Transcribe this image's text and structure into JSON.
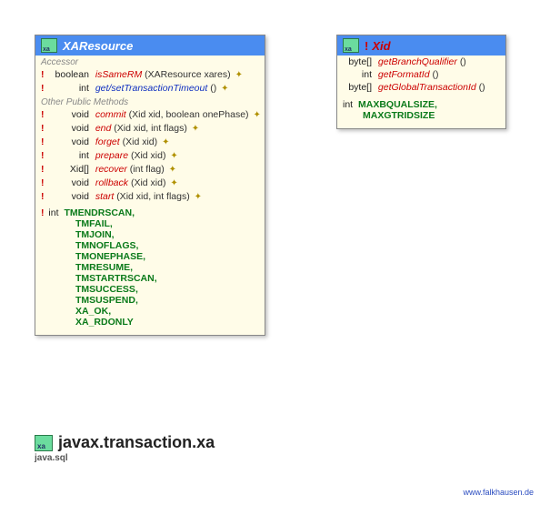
{
  "xaresource": {
    "title": "XAResource",
    "sections": {
      "accessor_label": "Accessor",
      "other_label": "Other Public Methods"
    },
    "accessors": [
      {
        "bang": "!",
        "ret": "boolean",
        "name": "isSameRM",
        "params": "(XAResource xares)",
        "throws": "✦",
        "color": "red"
      },
      {
        "bang": "!",
        "ret": "int",
        "name": "get/setTransactionTimeout",
        "params": "()",
        "throws": "✦",
        "color": "blue"
      }
    ],
    "methods": [
      {
        "bang": "!",
        "ret": "void",
        "name": "commit",
        "params": "(Xid xid, boolean onePhase)",
        "throws": "✦"
      },
      {
        "bang": "!",
        "ret": "void",
        "name": "end",
        "params": "(Xid xid, int flags)",
        "throws": "✦"
      },
      {
        "bang": "!",
        "ret": "void",
        "name": "forget",
        "params": "(Xid xid)",
        "throws": "✦"
      },
      {
        "bang": "!",
        "ret": "int",
        "name": "prepare",
        "params": "(Xid xid)",
        "throws": "✦"
      },
      {
        "bang": "!",
        "ret": "Xid[]",
        "name": "recover",
        "params": "(int flag)",
        "throws": "✦"
      },
      {
        "bang": "!",
        "ret": "void",
        "name": "rollback",
        "params": "(Xid xid)",
        "throws": "✦"
      },
      {
        "bang": "!",
        "ret": "void",
        "name": "start",
        "params": "(Xid xid, int flags)",
        "throws": "✦"
      }
    ],
    "constants": {
      "lead": "!",
      "type": "int",
      "names": [
        "TMENDRSCAN",
        "TMFAIL",
        "TMJOIN",
        "TMNOFLAGS",
        "TMONEPHASE",
        "TMRESUME",
        "TMSTARTRSCAN",
        "TMSUCCESS",
        "TMSUSPEND",
        "XA_OK",
        "XA_RDONLY"
      ]
    }
  },
  "xid": {
    "bang": "!",
    "title": "Xid",
    "methods": [
      {
        "ret": "byte[]",
        "name": "getBranchQualifier",
        "params": "()"
      },
      {
        "ret": "int",
        "name": "getFormatId",
        "params": "()"
      },
      {
        "ret": "byte[]",
        "name": "getGlobalTransactionId",
        "params": "()"
      }
    ],
    "constants": {
      "type": "int",
      "names": [
        "MAXBQUALSIZE",
        "MAXGTRIDSIZE"
      ]
    }
  },
  "package": {
    "name": "javax.transaction.xa",
    "sub": "java.sql"
  },
  "footer": "www.falkhausen.de"
}
